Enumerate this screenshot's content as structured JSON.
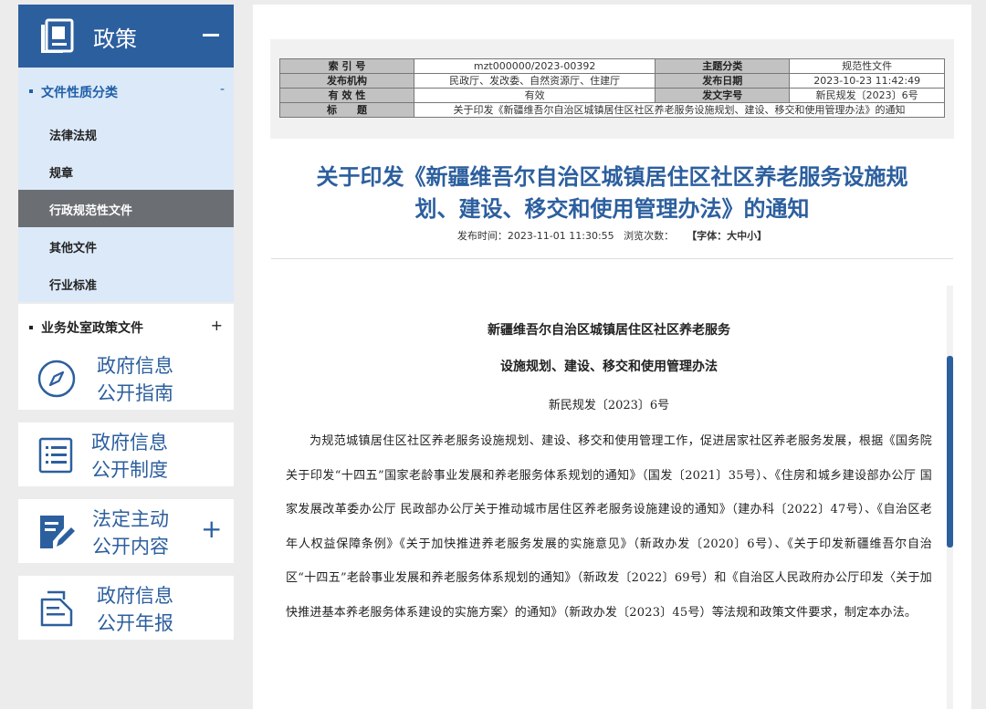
{
  "sidebar": {
    "header_title": "政策",
    "cat1": {
      "label": "文件性质分类",
      "toggle": "-"
    },
    "sub_items": [
      {
        "label": "法律法规"
      },
      {
        "label": "规章"
      },
      {
        "label": "行政规范性文件"
      },
      {
        "label": "其他文件"
      },
      {
        "label": "行业标准"
      }
    ],
    "cat2": {
      "label": "业务处室政策文件",
      "toggle": "+"
    },
    "cards": [
      {
        "line1": "政府信息",
        "line2": "公开指南",
        "icon": "compass-icon"
      },
      {
        "line1": "政府信息",
        "line2": "公开制度",
        "icon": "list-icon"
      },
      {
        "line1": "法定主动",
        "line2": "公开内容",
        "icon": "edit-document-icon",
        "plus": "+"
      },
      {
        "line1": "政府信息",
        "line2": "公开年报",
        "icon": "report-icon"
      }
    ]
  },
  "meta": {
    "r1": {
      "k1": "索 引 号",
      "v1": "mzt000000/2023-00392",
      "k2": "主题分类",
      "v2": "规范性文件"
    },
    "r2": {
      "k1": "发布机构",
      "v1": "民政厅、发改委、自然资源厅、住建厅",
      "k2": "发布日期",
      "v2": "2023-10-23 11:42:49"
    },
    "r3": {
      "k1": "有 效 性",
      "v1": "有效",
      "k2": "发文字号",
      "v2": "新民规发〔2023〕6号"
    },
    "r4": {
      "k1": "标　　题",
      "v1": "关于印发《新疆维吾尔自治区城镇居住区社区养老服务设施规划、建设、移交和使用管理办法》的通知"
    }
  },
  "doc": {
    "title_line1": "关于印发《新疆维吾尔自治区城镇居住区社区养老服务设施规",
    "title_line2": "划、建设、移交和使用管理办法》的通知",
    "publish_label": "发布时间：",
    "publish_time": "2023-11-01 11:30:55",
    "views_label": "浏览次数：",
    "font_size_ctrl": "【字体：大中小】",
    "heading1": "新疆维吾尔自治区城镇居住区社区养老服务",
    "heading2": "设施规划、建设、移交和使用管理办法",
    "doc_number": "新民规发〔2023〕6号",
    "paragraph": "为规范城镇居住区社区养老服务设施规划、建设、移交和使用管理工作，促进居家社区养老服务发展，根据《国务院关于印发“十四五”国家老龄事业发展和养老服务体系规划的通知》（国发〔2021〕35号）、《住房和城乡建设部办公厅 国家发展改革委办公厅 民政部办公厅关于推动城市居住区养老服务设施建设的通知》（建办科〔2022〕47号）、《自治区老年人权益保障条例》《关于加快推进养老服务发展的实施意见》（新政办发〔2020〕6号）、《关于印发新疆维吾尔自治区“十四五”老龄事业发展和养老服务体系规划的通知》（新政发〔2022〕69号）和《自治区人民政府办公厅印发〈关于加快推进基本养老服务体系建设的实施方案〉的通知》（新政办发〔2023〕45号）等法规和政策文件要求，制定本办法。"
  }
}
